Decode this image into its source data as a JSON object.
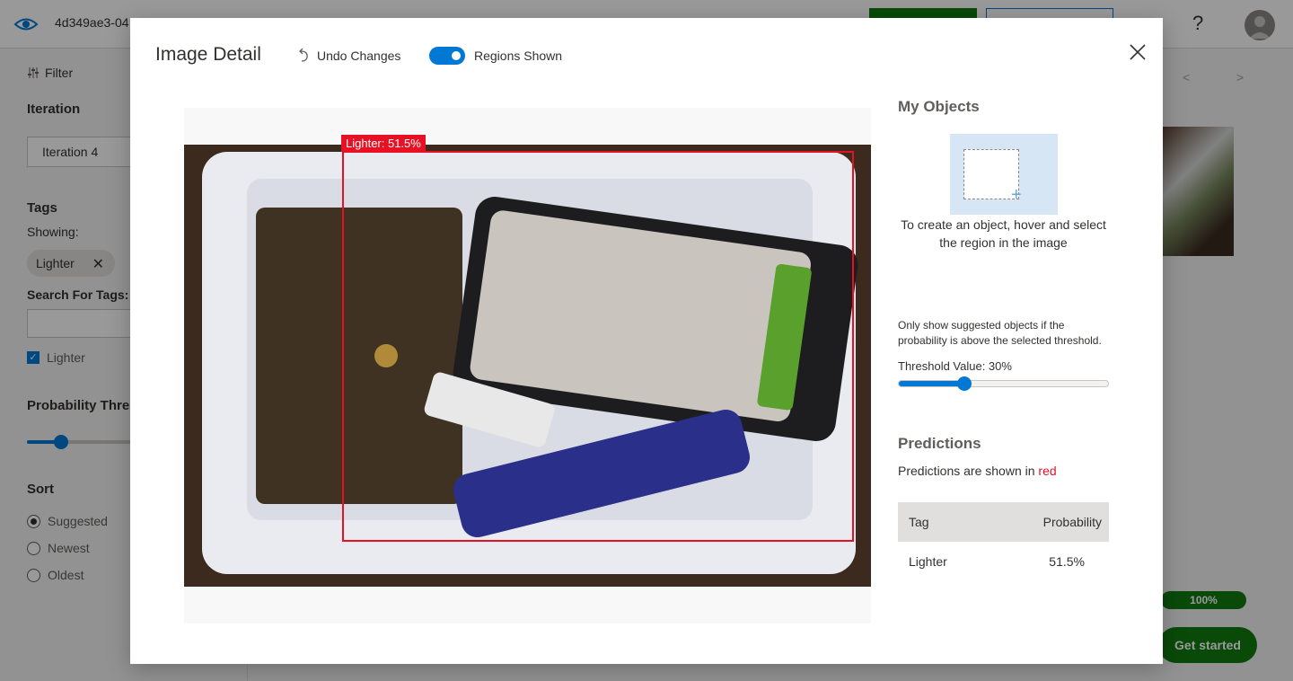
{
  "app": {
    "project_id": "4d349ae3-04",
    "help_glyph": "?",
    "get_started": "Get started",
    "progress": "100%",
    "progress_value": 1.0,
    "pager_prev": "<",
    "pager_next": ">"
  },
  "sidebar": {
    "filter": "Filter",
    "iteration_heading": "Iteration",
    "iteration_value": "Iteration 4",
    "tags_heading": "Tags",
    "showing_label": "Showing:",
    "chip_label": "Lighter",
    "search_label": "Search For Tags:",
    "search_value": "",
    "tag_checkbox": "Lighter",
    "tag_checked": true,
    "probability_heading": "Probability Thres",
    "sort_heading": "Sort",
    "sort_options": [
      "Suggested",
      "Newest",
      "Oldest"
    ],
    "sort_selected": "Suggested"
  },
  "modal": {
    "title": "Image Detail",
    "undo": "Undo Changes",
    "regions_toggle": "Regions Shown",
    "regions_on": true,
    "region_label": "Lighter: 51.5%",
    "my_objects_heading": "My Objects",
    "objects_caption": "To create an object, hover and select the region in the image",
    "threshold_note": "Only show suggested objects if the probability is above the selected threshold.",
    "threshold_label": "Threshold Value: 30%",
    "threshold_value": 30,
    "predictions_heading": "Predictions",
    "predictions_note_prefix": "Predictions are shown in ",
    "predictions_note_color_word": "red",
    "table": {
      "headers": [
        "Tag",
        "Probability"
      ],
      "rows": [
        {
          "tag": "Lighter",
          "probability": "51.5%"
        }
      ]
    }
  },
  "colors": {
    "accent": "#0078d4",
    "prediction": "#e81123",
    "green": "#107c10"
  },
  "icons": {
    "logo": "eye-icon",
    "filter": "filter-icon",
    "undo": "undo-icon",
    "close": "close-icon",
    "avatar": "user-avatar-icon"
  }
}
